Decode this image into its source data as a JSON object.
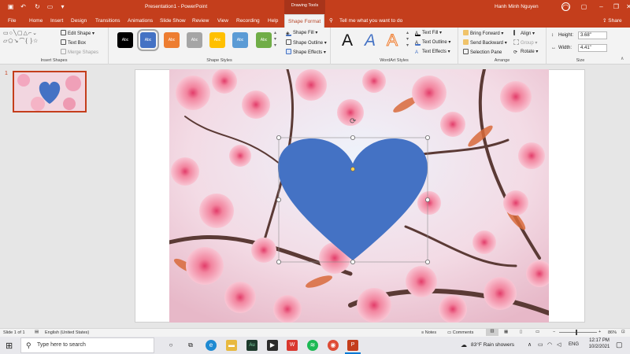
{
  "titlebar": {
    "doc_title": "Presentation1  -  PowerPoint",
    "context_header": "Drawing Tools",
    "user": "Hanh Minh Nguyen",
    "share": "Share"
  },
  "tabs": [
    "File",
    "Home",
    "Insert",
    "Design",
    "Transitions",
    "Animations",
    "Slide Show",
    "Review",
    "View",
    "Recording",
    "Help",
    "Shape Format"
  ],
  "active_tab": "Shape Format",
  "tell_me": "Tell me what you want to do",
  "ribbon": {
    "insert_shapes": {
      "label": "Insert Shapes",
      "edit_shape": "Edit Shape",
      "text_box": "Text Box",
      "merge_shapes": "Merge Shapes"
    },
    "shape_styles": {
      "label": "Shape Styles",
      "swatch_text": "Abc",
      "swatches": [
        "#000000",
        "#4472c4",
        "#ed7d31",
        "#a5a5a5",
        "#ffc000",
        "#5b9bd5",
        "#70ad47"
      ],
      "shape_fill": "Shape Fill",
      "shape_outline": "Shape Outline",
      "shape_effects": "Shape Effects"
    },
    "wordart": {
      "label": "WordArt Styles",
      "sample": "A",
      "text_fill": "Text Fill",
      "text_outline": "Text Outline",
      "text_effects": "Text Effects"
    },
    "arrange": {
      "label": "Arrange",
      "bring_forward": "Bring Forward",
      "send_backward": "Send Backward",
      "selection_pane": "Selection Pane",
      "align": "Align",
      "group": "Group",
      "rotate": "Rotate"
    },
    "size": {
      "label": "Size",
      "height_label": "Height:",
      "height_value": "3.68\"",
      "width_label": "Width:",
      "width_value": "4.41\""
    }
  },
  "thumbnail": {
    "number": "1"
  },
  "statusbar": {
    "slide_info": "Slide 1 of 1",
    "language": "English (United States)",
    "notes": "Notes",
    "comments": "Comments",
    "zoom": "86%"
  },
  "taskbar": {
    "search_placeholder": "Type here to search",
    "weather": "83°F  Rain showers",
    "lang": "ENG",
    "time": "12:17 PM",
    "date": "10/2/2021"
  },
  "colors": {
    "accent": "#c43e1c",
    "heart": "#4472c4"
  }
}
